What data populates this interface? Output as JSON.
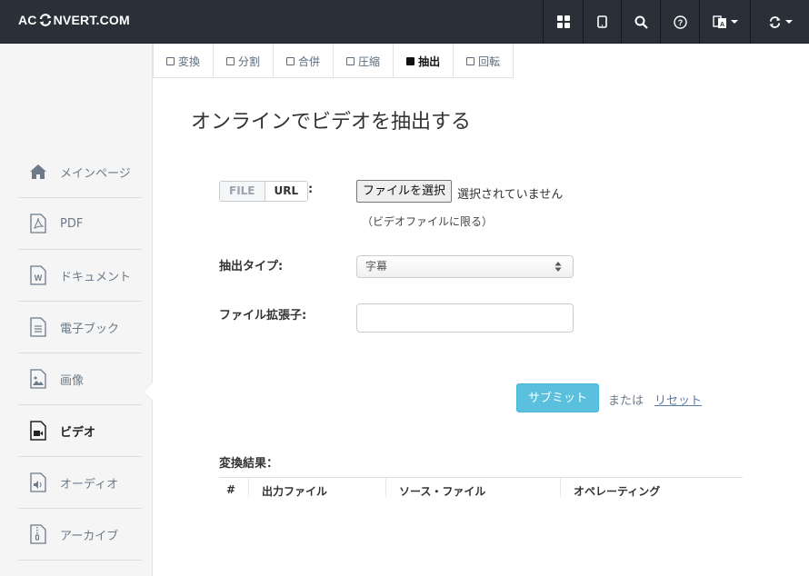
{
  "header": {
    "logo_pre": "AC",
    "logo_post": "NVERT.COM"
  },
  "nav_icons": [
    "grid-icon",
    "tablet-icon",
    "search-icon",
    "help-icon",
    "language-icon",
    "sync-icon"
  ],
  "tabs": [
    {
      "label": "変換",
      "active": false
    },
    {
      "label": "分割",
      "active": false
    },
    {
      "label": "合併",
      "active": false
    },
    {
      "label": "圧縮",
      "active": false
    },
    {
      "label": "抽出",
      "active": true
    },
    {
      "label": "回転",
      "active": false
    }
  ],
  "page_title": "オンラインでビデオを抽出する",
  "sidebar": {
    "items": [
      {
        "label": "メインページ",
        "icon": "home-icon"
      },
      {
        "label": "PDF",
        "icon": "pdf-file-icon"
      },
      {
        "label": "ドキュメント",
        "icon": "word-file-icon"
      },
      {
        "label": "電子ブック",
        "icon": "ebook-file-icon"
      },
      {
        "label": "画像",
        "icon": "image-file-icon"
      },
      {
        "label": "ビデオ",
        "icon": "video-file-icon",
        "active": true
      },
      {
        "label": "オーディオ",
        "icon": "audio-file-icon"
      },
      {
        "label": "アーカイブ",
        "icon": "archive-file-icon"
      }
    ]
  },
  "form": {
    "source_file": "FILE",
    "source_url": "URL",
    "colon": ":",
    "choose_file_button": "ファイルを選択",
    "file_status": "選択されていません",
    "file_hint": "（ビデオファイルに限る）",
    "extract_type_label": "抽出タイプ:",
    "extract_type_value": "字幕",
    "extension_label": "ファイル拡張子:",
    "extension_value": "",
    "submit_label": "サブミット",
    "or_text": "または",
    "reset_label": "リセット"
  },
  "results": {
    "title": "変換結果：",
    "columns": [
      "#",
      "出力ファイル",
      "ソース・ファイル",
      "オペレーティング"
    ]
  },
  "colors": {
    "topbar": "#2a3038",
    "submit": "#5bc0de",
    "link": "#5a7ca8"
  }
}
